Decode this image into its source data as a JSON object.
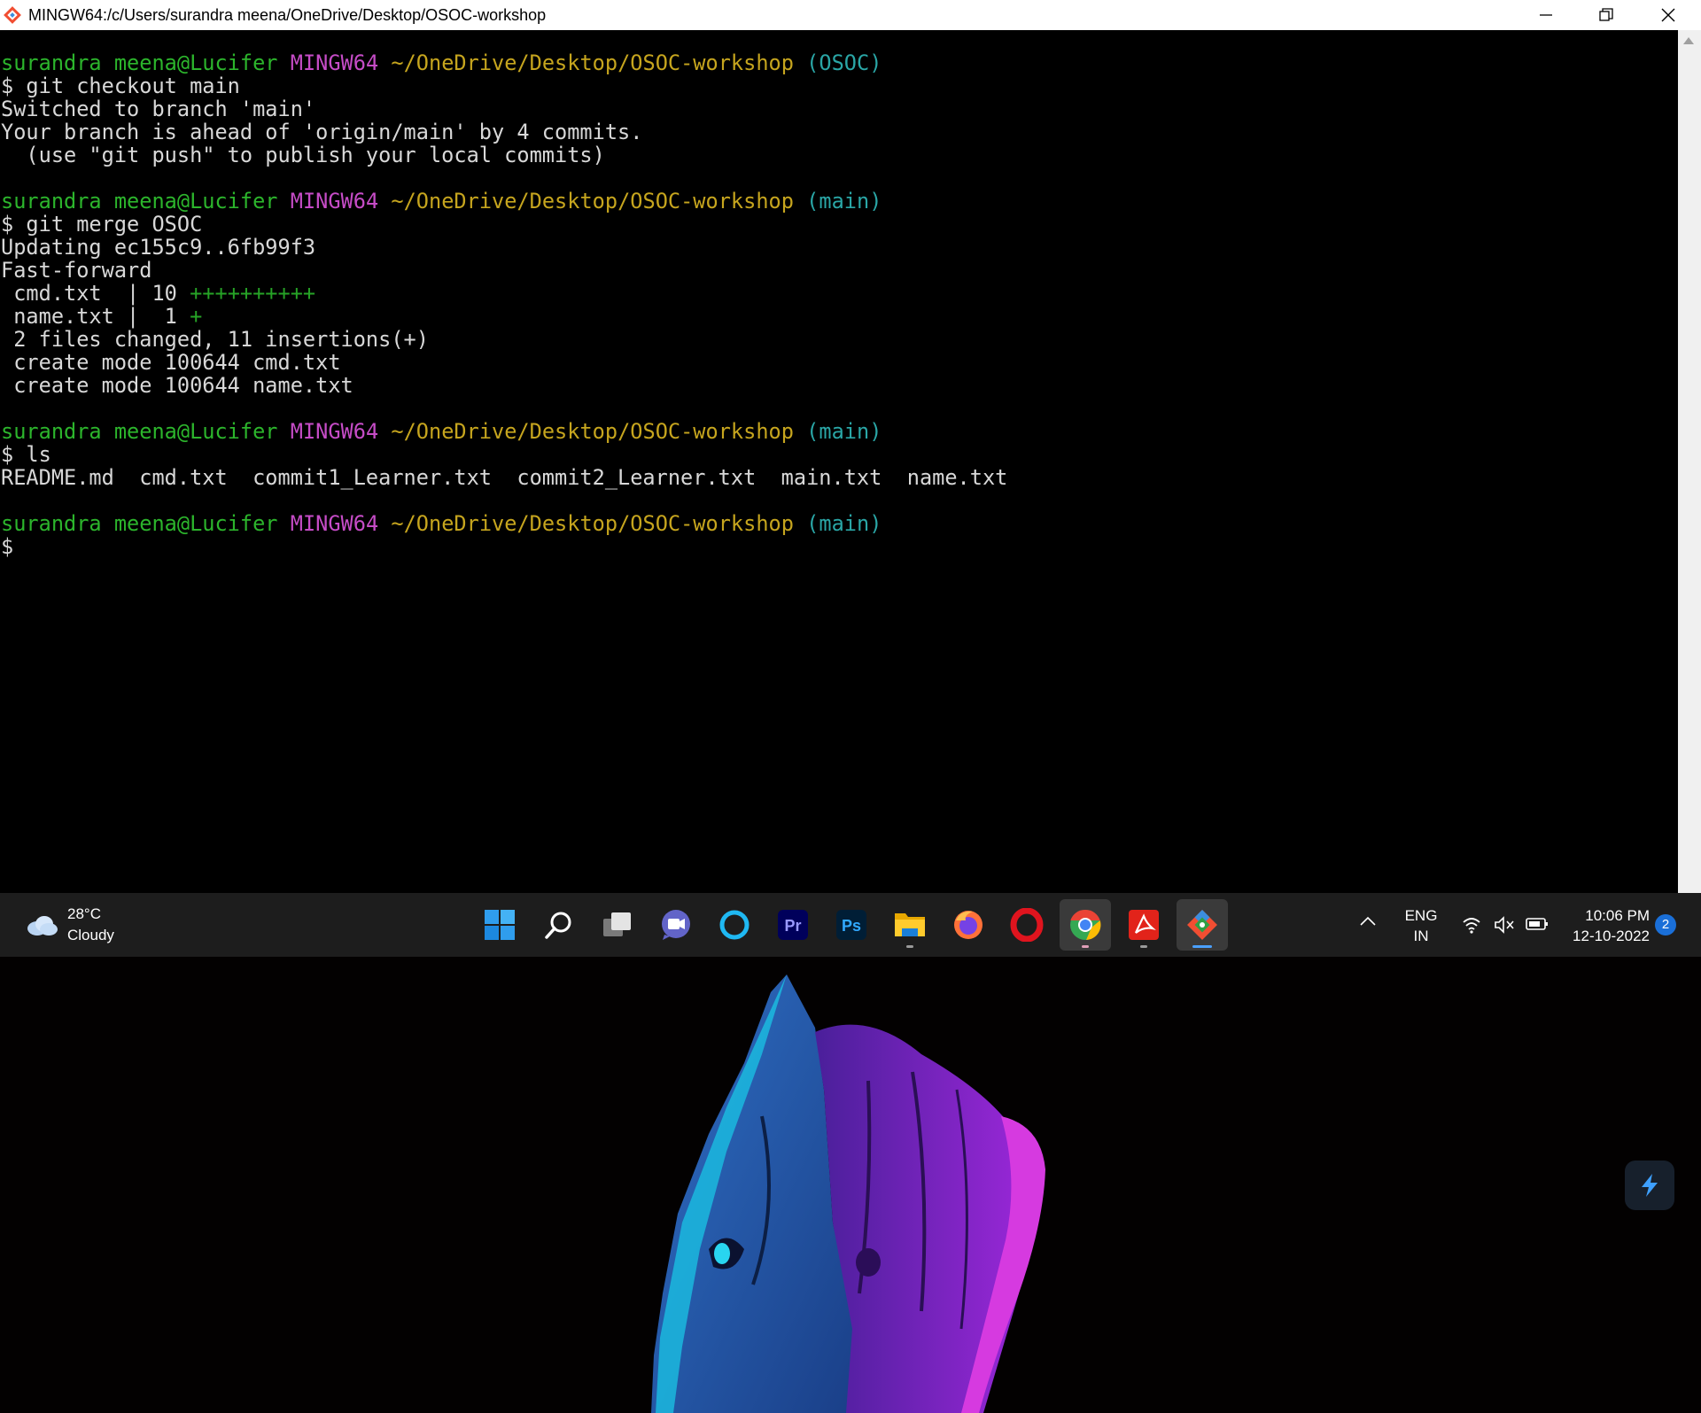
{
  "window": {
    "title": "MINGW64:/c/Users/surandra meena/OneDrive/Desktop/OSOC-workshop",
    "minimize_icon": "minimize-icon",
    "restore_icon": "restore-icon",
    "close_icon": "close-icon"
  },
  "terminal": {
    "prompts": [
      {
        "user": "surandra meena@Lucifer",
        "env": "MINGW64",
        "path": "~/OneDrive/Desktop/OSOC-workshop",
        "branch": "(OSOC)"
      },
      {
        "user": "surandra meena@Lucifer",
        "env": "MINGW64",
        "path": "~/OneDrive/Desktop/OSOC-workshop",
        "branch": "(main)"
      },
      {
        "user": "surandra meena@Lucifer",
        "env": "MINGW64",
        "path": "~/OneDrive/Desktop/OSOC-workshop",
        "branch": "(main)"
      },
      {
        "user": "surandra meena@Lucifer",
        "env": "MINGW64",
        "path": "~/OneDrive/Desktop/OSOC-workshop",
        "branch": "(main)"
      }
    ],
    "commands": [
      "$ git checkout main",
      "$ git merge OSOC",
      "$ ls",
      "$"
    ],
    "output1": [
      "Switched to branch 'main'",
      "Your branch is ahead of 'origin/main' by 4 commits.",
      "  (use \"git push\" to publish your local commits)"
    ],
    "output2": {
      "updating": "Updating ec155c9..6fb99f3",
      "fast_forward": "Fast-forward",
      "stat1_prefix": " cmd.txt  | 10 ",
      "stat1_plus": "++++++++++",
      "stat2_prefix": " name.txt |  1 ",
      "stat2_plus": "+",
      "summary": " 2 files changed, 11 insertions(+)",
      "create1": " create mode 100644 cmd.txt",
      "create2": " create mode 100644 name.txt"
    },
    "ls_output": "README.md  cmd.txt  commit1_Learner.txt  commit2_Learner.txt  main.txt  name.txt"
  },
  "taskbar": {
    "weather": {
      "temp": "28°C",
      "condition": "Cloudy",
      "icon": "cloud-icon"
    },
    "apps": [
      {
        "name": "start-icon",
        "color": "#39a8f0"
      },
      {
        "name": "search-icon",
        "color": "#ffffff"
      },
      {
        "name": "task-view-icon",
        "color": "#d0d0d0"
      },
      {
        "name": "teams-chat-icon",
        "color": "#7b83eb"
      },
      {
        "name": "cortana-icon",
        "color": "#1fb8f2"
      },
      {
        "name": "premiere-pro-icon",
        "label": "Pr",
        "color": "#9999ff"
      },
      {
        "name": "photoshop-icon",
        "label": "Ps",
        "color": "#31a8ff"
      },
      {
        "name": "file-explorer-icon",
        "color": "#f5c400"
      },
      {
        "name": "firefox-icon",
        "color": "#ff7139"
      },
      {
        "name": "opera-icon",
        "color": "#e0141e"
      },
      {
        "name": "chrome-icon",
        "color": "#34a853"
      },
      {
        "name": "acrobat-icon",
        "color": "#e2231a"
      },
      {
        "name": "git-bash-icon",
        "color": "#f14e32"
      }
    ],
    "tray": {
      "chevron_icon": "chevron-up-icon",
      "lang_line1": "ENG",
      "lang_line2": "IN",
      "wifi_icon": "wifi-icon",
      "volume_icon": "volume-muted-icon",
      "battery_icon": "battery-icon",
      "time": "10:06 PM",
      "date": "12-10-2022",
      "notification_count": "2"
    }
  },
  "desktop": {
    "wallpaper": "groot-wallpaper",
    "widget_icon": "lightning-widget-icon"
  }
}
